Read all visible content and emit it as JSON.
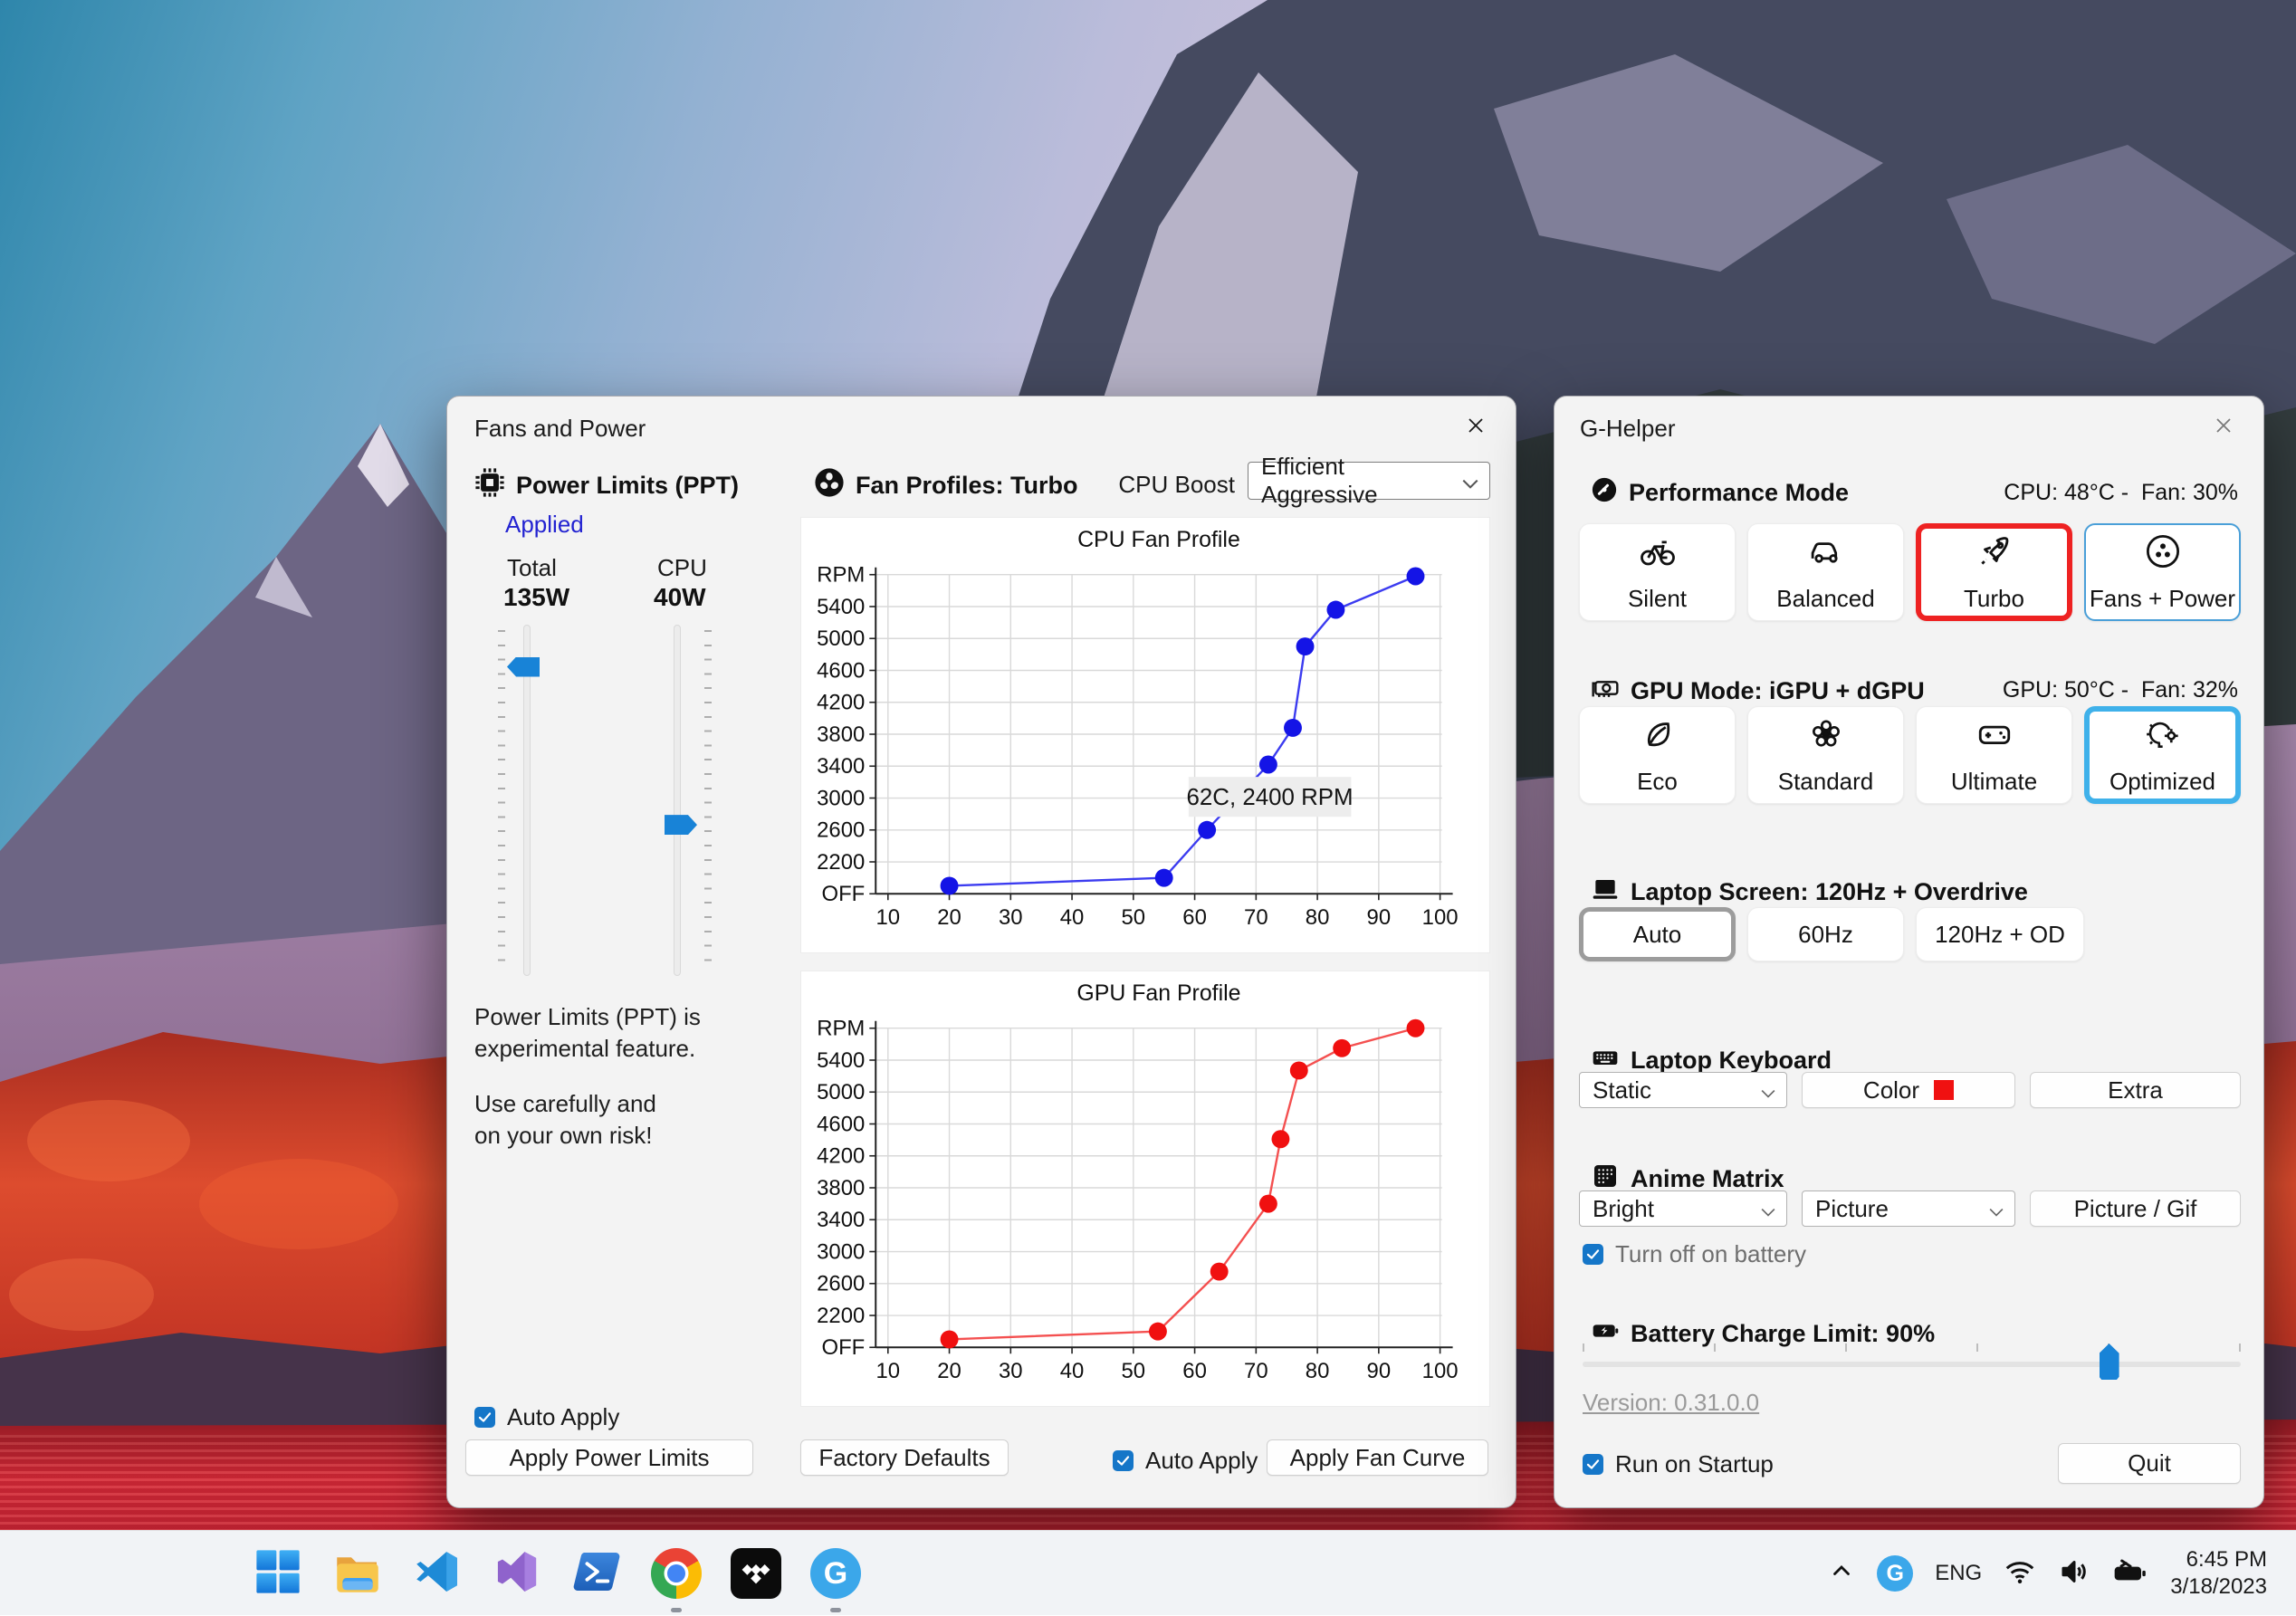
{
  "colors": {
    "accent": "#1576c8",
    "turbo_border": "#ee2222",
    "fans_power_border": "#4a9fd8",
    "optimized_border": "#3fb1ea",
    "applied_text": "#2323d1",
    "keyboard_color_swatch": "#f01111",
    "cpu_series": "#1414e6",
    "gpu_series": "#f01010"
  },
  "fans_window": {
    "title": "Fans and Power",
    "power_limits": {
      "header": "Power Limits (PPT)",
      "status": "Applied",
      "sliders": [
        {
          "label": "Total",
          "value": "135W",
          "percent": 12
        },
        {
          "label": "CPU",
          "value": "40W",
          "percent": 57
        }
      ],
      "note1": "Power Limits (PPT) is\nexperimental feature.",
      "note2": "Use carefully and\non your own risk!",
      "auto_apply": "Auto Apply",
      "apply_button": "Apply Power Limits"
    },
    "fan_profiles": {
      "header": "Fan Profiles: Turbo",
      "cpu_boost_label": "CPU Boost",
      "cpu_boost_value": "Efficient Aggressive",
      "factory_defaults": "Factory Defaults",
      "auto_apply": "Auto Apply",
      "apply_button": "Apply Fan Curve"
    }
  },
  "chart_data": [
    {
      "type": "line",
      "title": "CPU Fan Profile",
      "color": "#1414e6",
      "line_color": "#3c3cf0",
      "x": [
        20,
        55,
        62,
        72,
        76,
        78,
        83,
        96
      ],
      "y": [
        1900,
        2000,
        2600,
        3420,
        3880,
        4900,
        5360,
        5780
      ],
      "x_ticks": [
        10,
        20,
        30,
        40,
        50,
        60,
        70,
        80,
        90,
        100
      ],
      "y_tick_values": [
        1800,
        2200,
        2600,
        3000,
        3400,
        3800,
        4200,
        4600,
        5000,
        5400,
        5800
      ],
      "y_tick_labels": [
        "OFF",
        "2200",
        "2600",
        "3000",
        "3400",
        "3800",
        "4200",
        "4600",
        "5000",
        "5400",
        "RPM"
      ],
      "x_range": [
        8,
        100.3
      ],
      "y_range": [
        1800,
        5800
      ],
      "grid": true,
      "legend": "none",
      "xlabel": "",
      "ylabel": "",
      "tooltip": {
        "text": "62C, 2400 RPM",
        "x_from": 59,
        "x_to": 85.5,
        "y_from": 2765,
        "y_to": 3265
      }
    },
    {
      "type": "line",
      "title": "GPU Fan Profile",
      "color": "#f01010",
      "line_color": "#f45050",
      "x": [
        20,
        54,
        64,
        72,
        74,
        77,
        84,
        96
      ],
      "y": [
        1900,
        2000,
        2750,
        3600,
        4410,
        5270,
        5550,
        5800
      ],
      "x_ticks": [
        10,
        20,
        30,
        40,
        50,
        60,
        70,
        80,
        90,
        100
      ],
      "y_tick_values": [
        1800,
        2200,
        2600,
        3000,
        3400,
        3800,
        4200,
        4600,
        5000,
        5400,
        5800
      ],
      "y_tick_labels": [
        "OFF",
        "2200",
        "2600",
        "3000",
        "3400",
        "3800",
        "4200",
        "4600",
        "5000",
        "5400",
        "RPM"
      ],
      "x_range": [
        8,
        100.3
      ],
      "y_range": [
        1800,
        5800
      ],
      "grid": true,
      "legend": "none",
      "xlabel": "",
      "ylabel": ""
    }
  ],
  "ghelper": {
    "title": "G-Helper",
    "performance": {
      "header": "Performance Mode",
      "status": "CPU: 48°C -  Fan: 30%",
      "buttons": [
        {
          "label": "Silent"
        },
        {
          "label": "Balanced"
        },
        {
          "label": "Turbo",
          "selected": "red"
        },
        {
          "label": "Fans + Power",
          "selected": "thin-blue"
        }
      ]
    },
    "gpu": {
      "header": "GPU Mode: iGPU + dGPU",
      "status": "GPU: 50°C -  Fan: 32%",
      "buttons": [
        {
          "label": "Eco"
        },
        {
          "label": "Standard"
        },
        {
          "label": "Ultimate"
        },
        {
          "label": "Optimized",
          "selected": "light-blue"
        }
      ]
    },
    "screen": {
      "header": "Laptop Screen: 120Hz + Overdrive",
      "buttons": [
        {
          "label": "Auto",
          "selected": "gray"
        },
        {
          "label": "60Hz"
        },
        {
          "label": "120Hz + OD"
        }
      ]
    },
    "keyboard": {
      "header": "Laptop Keyboard",
      "mode": "Static",
      "color": "Color",
      "extra": "Extra"
    },
    "anime": {
      "header": "Anime Matrix",
      "brightness": "Bright",
      "mode": "Picture",
      "picture_gif": "Picture / Gif",
      "battery_toggle": "Turn off on battery"
    },
    "battery": {
      "header": "Battery Charge Limit: 90%",
      "min": 50,
      "max": 100,
      "value": 90
    },
    "version": "Version: 0.31.0.0",
    "run_on_startup": "Run on Startup",
    "quit": "Quit"
  },
  "taskbar": {
    "apps": [
      {
        "name": "start",
        "running": false
      },
      {
        "name": "explorer",
        "running": false
      },
      {
        "name": "vscode",
        "running": false
      },
      {
        "name": "visual-studio",
        "running": false
      },
      {
        "name": "powershell",
        "running": false
      },
      {
        "name": "chrome",
        "running": true
      },
      {
        "name": "tidal",
        "running": false
      },
      {
        "name": "ghelper",
        "running": true,
        "glyph": "G"
      }
    ],
    "tray": {
      "language": "ENG",
      "time": "6:45 PM",
      "date": "3/18/2023",
      "ghelper_glyph": "G"
    }
  }
}
